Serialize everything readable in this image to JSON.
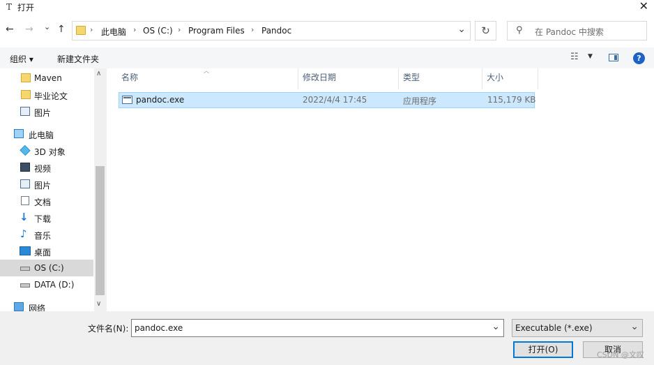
{
  "window": {
    "title": "打开",
    "app_icon_glyph": "T",
    "close_glyph": "✕"
  },
  "nav": {
    "back_glyph": "←",
    "forward_glyph": "→",
    "recent_glyph": "⌄",
    "up_glyph": "↑",
    "breadcrumb": [
      "此电脑",
      "OS (C:)",
      "Program Files",
      "Pandoc"
    ],
    "refresh_glyph": "↻",
    "search_placeholder": "在 Pandoc 中搜索"
  },
  "toolbar": {
    "organize_label": "组织 ▾",
    "new_folder_label": "新建文件夹",
    "view_glyph": "☷",
    "view_dd": "▼",
    "help_glyph": "?"
  },
  "sidebar": {
    "items": [
      {
        "label": "Maven",
        "icon": "folder-icon"
      },
      {
        "label": "毕业论文",
        "icon": "folder-icon"
      },
      {
        "label": "图片",
        "icon": "pictures-icon"
      },
      {
        "label": "此电脑",
        "icon": "computer-icon"
      },
      {
        "label": "3D 对象",
        "icon": "3d-objects-icon"
      },
      {
        "label": "视频",
        "icon": "videos-icon"
      },
      {
        "label": "图片",
        "icon": "pictures-icon"
      },
      {
        "label": "文档",
        "icon": "documents-icon"
      },
      {
        "label": "下载",
        "icon": "downloads-icon"
      },
      {
        "label": "音乐",
        "icon": "music-icon"
      },
      {
        "label": "桌面",
        "icon": "desktop-icon"
      },
      {
        "label": "OS (C:)",
        "icon": "drive-icon",
        "selected": true
      },
      {
        "label": "DATA (D:)",
        "icon": "drive-icon"
      },
      {
        "label": "网络",
        "icon": "network-icon"
      }
    ]
  },
  "columns": [
    "名称",
    "修改日期",
    "类型",
    "大小"
  ],
  "files": [
    {
      "name": "pandoc.exe",
      "modified": "2022/4/4 17:45",
      "type": "应用程序",
      "size": "115,179 KB",
      "selected": true
    }
  ],
  "bottom": {
    "filename_label": "文件名(N):",
    "filename_value": "pandoc.exe",
    "filetype_value": "Executable (*.exe)",
    "open_label": "打开(O)",
    "cancel_label": "取消"
  },
  "watermark": "CSDN @文叹",
  "colors": {
    "selection": "#cce8ff",
    "selection_border": "#99d1ff",
    "accent": "#0078d7",
    "folder": "#f6d66e"
  }
}
